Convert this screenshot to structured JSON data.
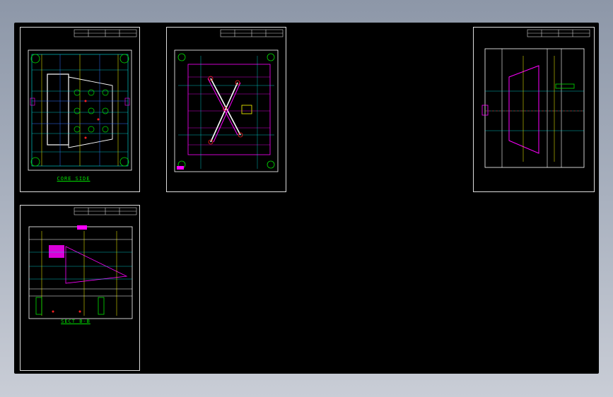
{
  "sheets": [
    {
      "caption": "CORE SIDE"
    },
    {
      "caption": ""
    },
    {
      "caption": ""
    },
    {
      "caption": "SECT B-B"
    }
  ],
  "colors": {
    "background": "#000000",
    "frame": "#dcdcdc",
    "plate": "#ffffff",
    "cyan": "#00e5e5",
    "green": "#00e000",
    "yellow": "#ffff00",
    "magenta": "#ff00ff",
    "red": "#ff2020",
    "blue": "#3070ff"
  }
}
